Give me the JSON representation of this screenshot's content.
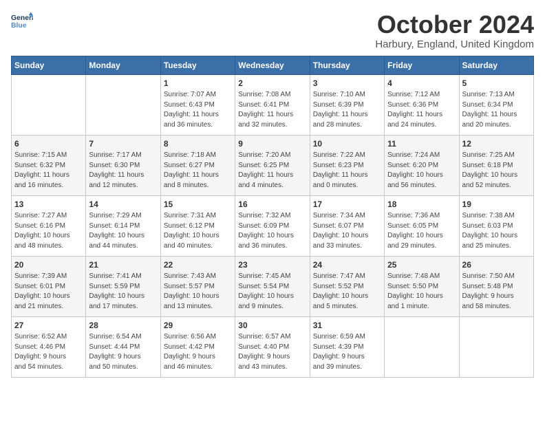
{
  "header": {
    "logo_line1": "General",
    "logo_line2": "Blue",
    "month_title": "October 2024",
    "location": "Harbury, England, United Kingdom"
  },
  "weekdays": [
    "Sunday",
    "Monday",
    "Tuesday",
    "Wednesday",
    "Thursday",
    "Friday",
    "Saturday"
  ],
  "weeks": [
    [
      {
        "day": "",
        "text": ""
      },
      {
        "day": "",
        "text": ""
      },
      {
        "day": "1",
        "text": "Sunrise: 7:07 AM\nSunset: 6:43 PM\nDaylight: 11 hours\nand 36 minutes."
      },
      {
        "day": "2",
        "text": "Sunrise: 7:08 AM\nSunset: 6:41 PM\nDaylight: 11 hours\nand 32 minutes."
      },
      {
        "day": "3",
        "text": "Sunrise: 7:10 AM\nSunset: 6:39 PM\nDaylight: 11 hours\nand 28 minutes."
      },
      {
        "day": "4",
        "text": "Sunrise: 7:12 AM\nSunset: 6:36 PM\nDaylight: 11 hours\nand 24 minutes."
      },
      {
        "day": "5",
        "text": "Sunrise: 7:13 AM\nSunset: 6:34 PM\nDaylight: 11 hours\nand 20 minutes."
      }
    ],
    [
      {
        "day": "6",
        "text": "Sunrise: 7:15 AM\nSunset: 6:32 PM\nDaylight: 11 hours\nand 16 minutes."
      },
      {
        "day": "7",
        "text": "Sunrise: 7:17 AM\nSunset: 6:30 PM\nDaylight: 11 hours\nand 12 minutes."
      },
      {
        "day": "8",
        "text": "Sunrise: 7:18 AM\nSunset: 6:27 PM\nDaylight: 11 hours\nand 8 minutes."
      },
      {
        "day": "9",
        "text": "Sunrise: 7:20 AM\nSunset: 6:25 PM\nDaylight: 11 hours\nand 4 minutes."
      },
      {
        "day": "10",
        "text": "Sunrise: 7:22 AM\nSunset: 6:23 PM\nDaylight: 11 hours\nand 0 minutes."
      },
      {
        "day": "11",
        "text": "Sunrise: 7:24 AM\nSunset: 6:20 PM\nDaylight: 10 hours\nand 56 minutes."
      },
      {
        "day": "12",
        "text": "Sunrise: 7:25 AM\nSunset: 6:18 PM\nDaylight: 10 hours\nand 52 minutes."
      }
    ],
    [
      {
        "day": "13",
        "text": "Sunrise: 7:27 AM\nSunset: 6:16 PM\nDaylight: 10 hours\nand 48 minutes."
      },
      {
        "day": "14",
        "text": "Sunrise: 7:29 AM\nSunset: 6:14 PM\nDaylight: 10 hours\nand 44 minutes."
      },
      {
        "day": "15",
        "text": "Sunrise: 7:31 AM\nSunset: 6:12 PM\nDaylight: 10 hours\nand 40 minutes."
      },
      {
        "day": "16",
        "text": "Sunrise: 7:32 AM\nSunset: 6:09 PM\nDaylight: 10 hours\nand 36 minutes."
      },
      {
        "day": "17",
        "text": "Sunrise: 7:34 AM\nSunset: 6:07 PM\nDaylight: 10 hours\nand 33 minutes."
      },
      {
        "day": "18",
        "text": "Sunrise: 7:36 AM\nSunset: 6:05 PM\nDaylight: 10 hours\nand 29 minutes."
      },
      {
        "day": "19",
        "text": "Sunrise: 7:38 AM\nSunset: 6:03 PM\nDaylight: 10 hours\nand 25 minutes."
      }
    ],
    [
      {
        "day": "20",
        "text": "Sunrise: 7:39 AM\nSunset: 6:01 PM\nDaylight: 10 hours\nand 21 minutes."
      },
      {
        "day": "21",
        "text": "Sunrise: 7:41 AM\nSunset: 5:59 PM\nDaylight: 10 hours\nand 17 minutes."
      },
      {
        "day": "22",
        "text": "Sunrise: 7:43 AM\nSunset: 5:57 PM\nDaylight: 10 hours\nand 13 minutes."
      },
      {
        "day": "23",
        "text": "Sunrise: 7:45 AM\nSunset: 5:54 PM\nDaylight: 10 hours\nand 9 minutes."
      },
      {
        "day": "24",
        "text": "Sunrise: 7:47 AM\nSunset: 5:52 PM\nDaylight: 10 hours\nand 5 minutes."
      },
      {
        "day": "25",
        "text": "Sunrise: 7:48 AM\nSunset: 5:50 PM\nDaylight: 10 hours\nand 1 minute."
      },
      {
        "day": "26",
        "text": "Sunrise: 7:50 AM\nSunset: 5:48 PM\nDaylight: 9 hours\nand 58 minutes."
      }
    ],
    [
      {
        "day": "27",
        "text": "Sunrise: 6:52 AM\nSunset: 4:46 PM\nDaylight: 9 hours\nand 54 minutes."
      },
      {
        "day": "28",
        "text": "Sunrise: 6:54 AM\nSunset: 4:44 PM\nDaylight: 9 hours\nand 50 minutes."
      },
      {
        "day": "29",
        "text": "Sunrise: 6:56 AM\nSunset: 4:42 PM\nDaylight: 9 hours\nand 46 minutes."
      },
      {
        "day": "30",
        "text": "Sunrise: 6:57 AM\nSunset: 4:40 PM\nDaylight: 9 hours\nand 43 minutes."
      },
      {
        "day": "31",
        "text": "Sunrise: 6:59 AM\nSunset: 4:39 PM\nDaylight: 9 hours\nand 39 minutes."
      },
      {
        "day": "",
        "text": ""
      },
      {
        "day": "",
        "text": ""
      }
    ]
  ]
}
